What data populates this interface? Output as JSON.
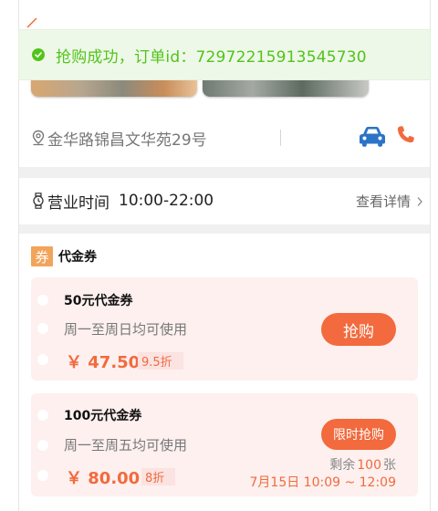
{
  "toast": {
    "message": "抢购成功，订单id：72972215913545730",
    "color": "#52c41a"
  },
  "store": {
    "address": "金华路锦昌文华苑29号",
    "hours_label": "营业时间",
    "hours_value": "10:00-22:00",
    "details_label": "查看详情"
  },
  "section": {
    "badge": "券",
    "title": "代金券"
  },
  "coupons": [
    {
      "name": "50元代金券",
      "desc": "周一至周日均可使用",
      "price": "￥ 47.50",
      "discount": "9.5折",
      "button": "抢购"
    },
    {
      "name": "100元代金券",
      "desc": "周一至周五均可使用",
      "price": "￥ 80.00",
      "discount": "8折",
      "button": "限时抢购",
      "stock_prefix": "剩余",
      "stock_count": "100",
      "stock_suffix": "张",
      "window": "7月15日 10:09 ~ 12:09"
    }
  ],
  "colors": {
    "accent": "#f26a3d",
    "success": "#52c41a",
    "badge": "#f2a45b",
    "coupon_bg": "#fdf0ef",
    "car": "#2b73c7"
  }
}
